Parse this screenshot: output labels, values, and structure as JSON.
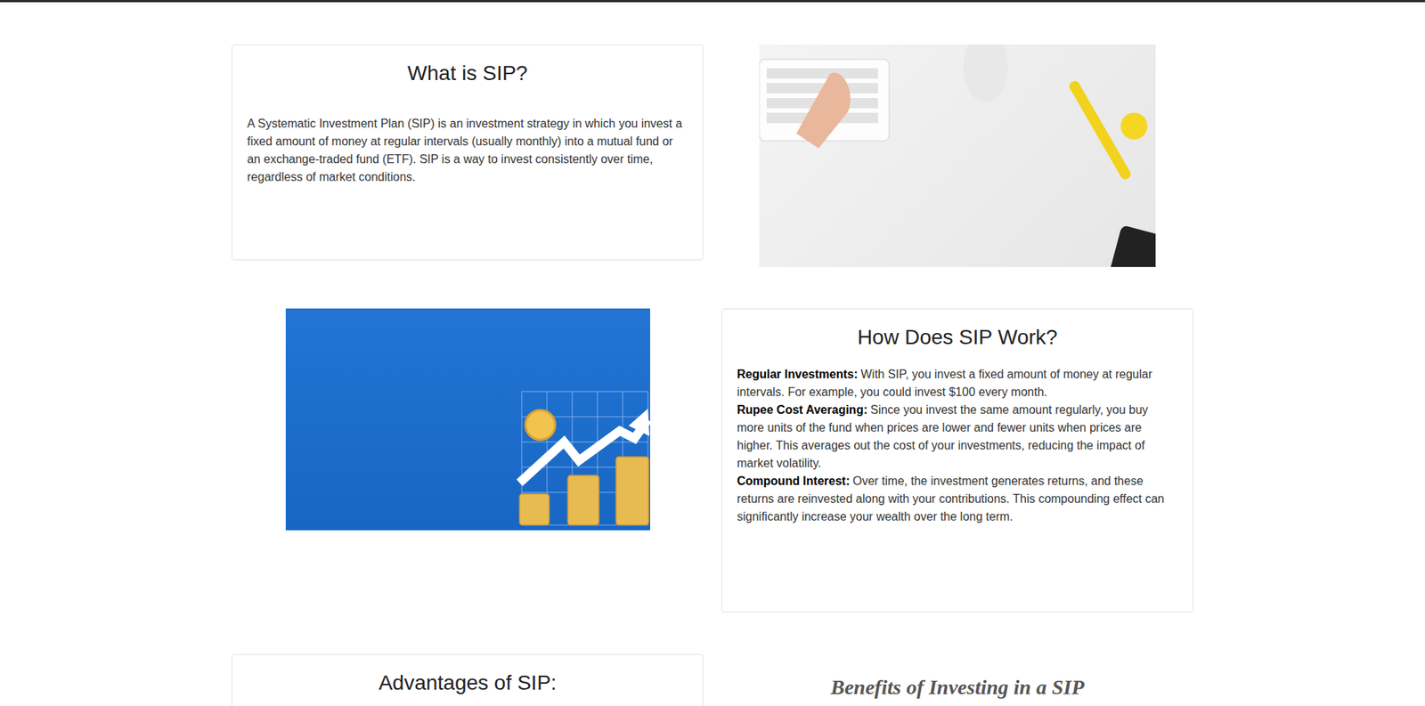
{
  "what_is_sip": {
    "title": "What is SIP?",
    "body": "A Systematic Investment Plan (SIP) is an investment strategy in which you invest a fixed amount of money at regular intervals (usually monthly) into a mutual fund or an exchange-traded fund (ETF). SIP is a way to invest consistently over time, regardless of market conditions."
  },
  "how_sip_works": {
    "title": "How Does SIP Work?",
    "points": [
      {
        "label": "Regular Investments:",
        "text": "With SIP, you invest a fixed amount of money at regular intervals. For example, you could invest $100 every month."
      },
      {
        "label": "Rupee Cost Averaging:",
        "text": "Since you invest the same amount regularly, you buy more units of the fund when prices are lower and fewer units when prices are higher. This averages out the cost of your investments, reducing the impact of market volatility."
      },
      {
        "label": "Compound Interest:",
        "text": "Over time, the investment generates returns, and these returns are reinvested along with your contributions. This compounding effect can significantly increase your wealth over the long term."
      }
    ]
  },
  "advantages": {
    "title": "Advantages of SIP:"
  },
  "benefits": {
    "title": "Benefits of Investing in a SIP"
  }
}
